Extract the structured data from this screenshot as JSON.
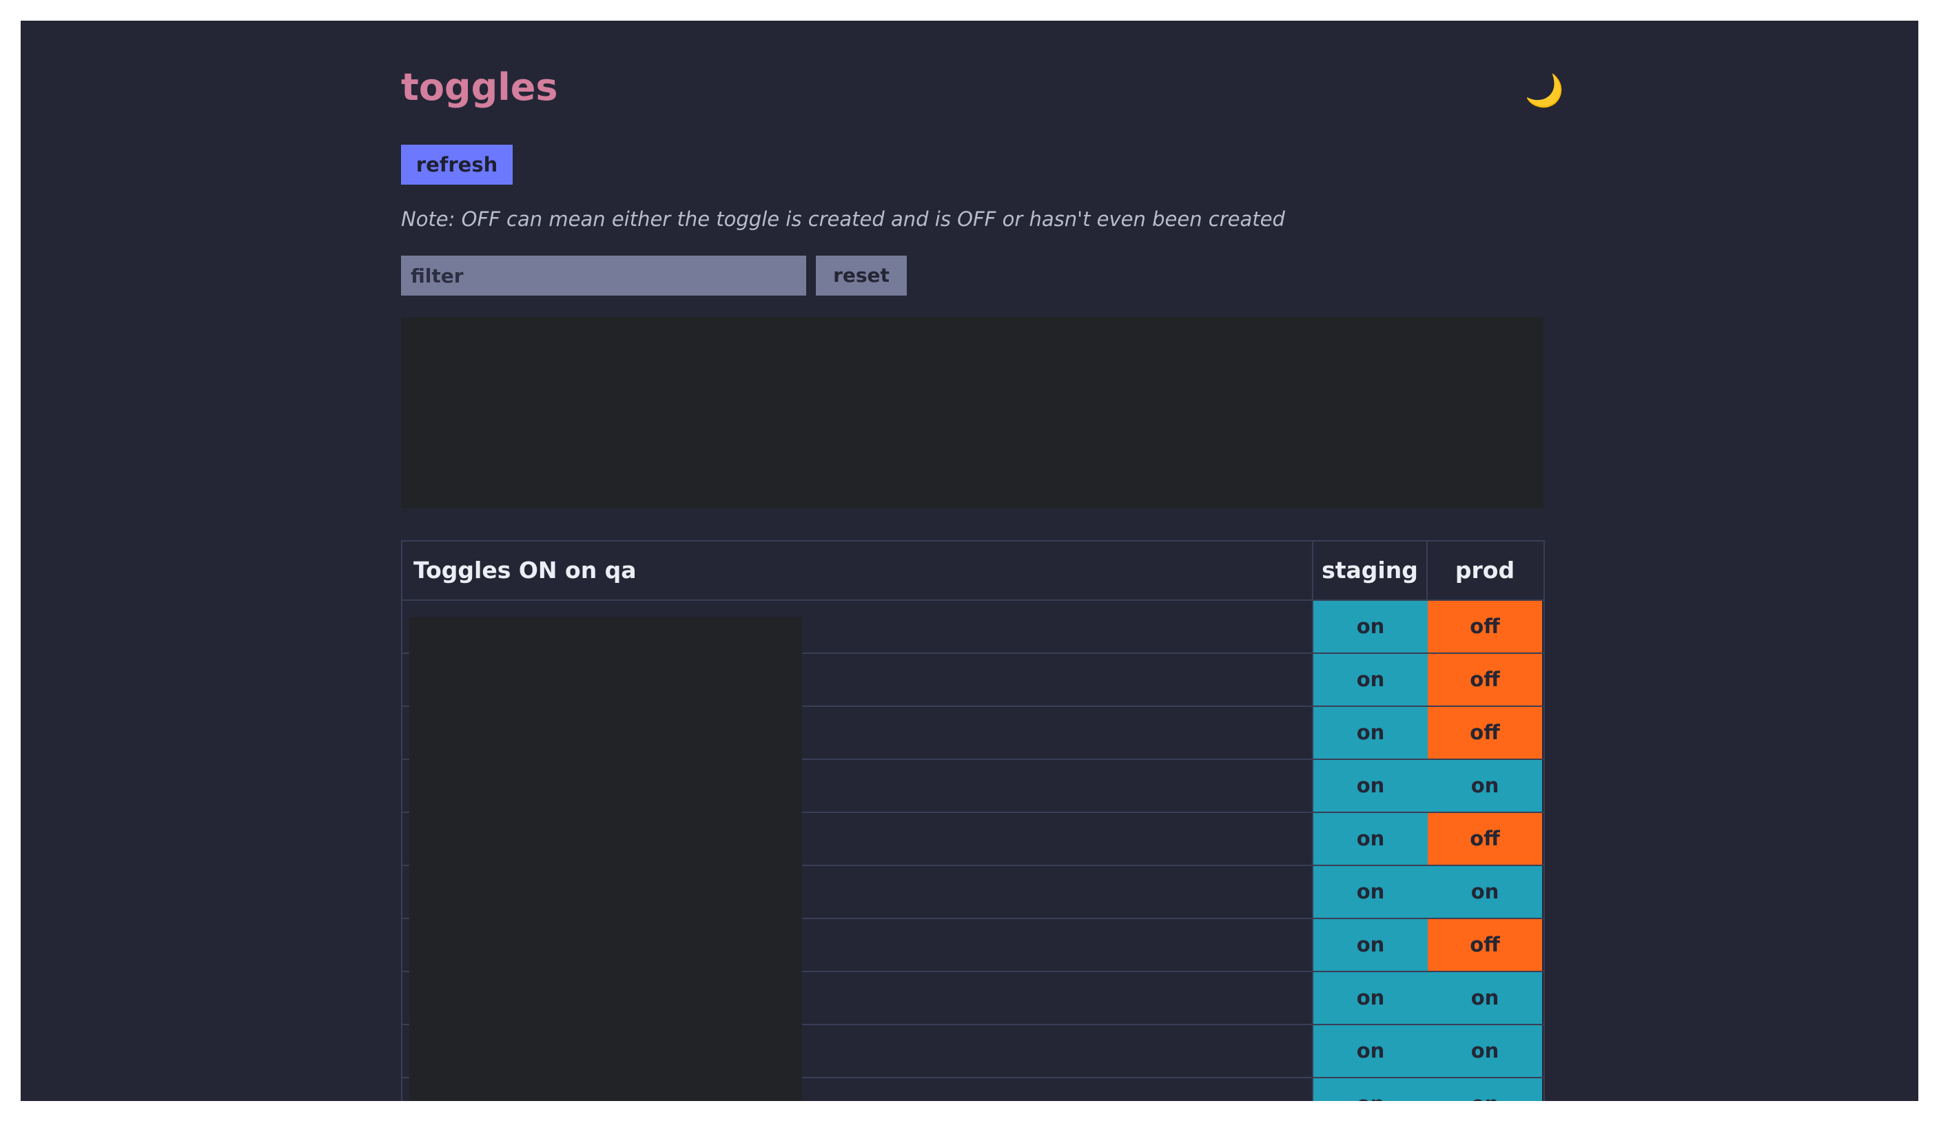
{
  "app": {
    "title": "toggles",
    "theme_icon": "moon-icon",
    "theme_glyph": "🌙"
  },
  "toolbar": {
    "refresh_label": "refresh"
  },
  "note": "Note: OFF can mean either the toggle is created and is OFF or hasn't even been created",
  "filter": {
    "placeholder": "filter",
    "value": "",
    "reset_label": "reset"
  },
  "table": {
    "headers": {
      "name": "Toggles ON on qa",
      "staging": "staging",
      "prod": "prod"
    },
    "rows": [
      {
        "staging": "on",
        "prod": "off"
      },
      {
        "staging": "on",
        "prod": "off"
      },
      {
        "staging": "on",
        "prod": "off"
      },
      {
        "staging": "on",
        "prod": "on"
      },
      {
        "staging": "on",
        "prod": "off"
      },
      {
        "staging": "on",
        "prod": "on"
      },
      {
        "staging": "on",
        "prod": "off"
      },
      {
        "staging": "on",
        "prod": "on"
      },
      {
        "staging": "on",
        "prod": "on"
      },
      {
        "staging": "on",
        "prod": "on"
      }
    ]
  },
  "colors": {
    "background": "#242635",
    "title": "#d37f9d",
    "refresh_button": "#6c79ff",
    "state_on": "#21a0b7",
    "state_off": "#ff6818",
    "redacted": "#222326"
  }
}
